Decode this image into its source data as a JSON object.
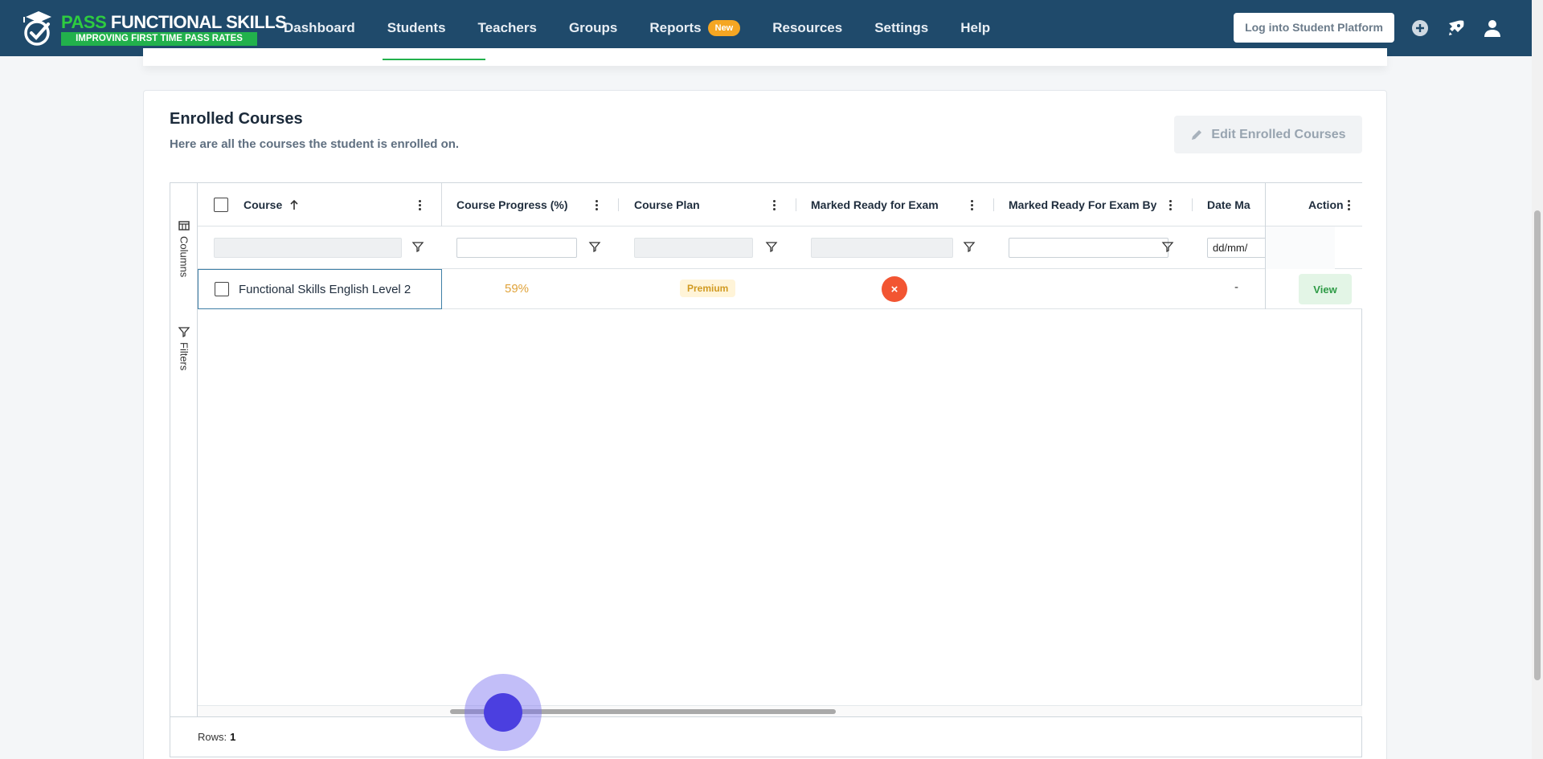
{
  "brand": {
    "word_pass": "PASS",
    "word_rest": " FUNCTIONAL SKILLS",
    "tagline": "IMPROVING FIRST TIME PASS RATES"
  },
  "nav": {
    "items": [
      "Dashboard",
      "Students",
      "Teachers",
      "Groups",
      "Reports",
      "Resources",
      "Settings",
      "Help"
    ],
    "reports_badge": "New",
    "login_button": "Log into Student Platform"
  },
  "card": {
    "title": "Enrolled Courses",
    "subtitle": "Here are all the courses the student is enrolled on.",
    "edit_button": "Edit Enrolled Courses"
  },
  "grid": {
    "side_columns": "Columns",
    "side_filters": "Filters",
    "columns": [
      "Course",
      "Course Progress (%)",
      "Course Plan",
      "Marked Ready for Exam",
      "Marked Ready For Exam By",
      "Date Ma",
      "Action"
    ],
    "date_placeholder": "dd/mm/",
    "rows": [
      {
        "course": "Functional Skills English Level 2",
        "progress": "59%",
        "plan": "Premium",
        "ready_icon": "×",
        "ready_by": "",
        "date": "-",
        "action": "View"
      }
    ],
    "footer_label": "Rows:",
    "footer_count": "1"
  },
  "colors": {
    "nav_bg": "#1f4a6b",
    "brand_green": "#22b14c",
    "badge_orange": "#f5a623",
    "progress_text": "#e0a33a",
    "not_ready_red": "#f25532",
    "view_green": "#2e9b46"
  }
}
